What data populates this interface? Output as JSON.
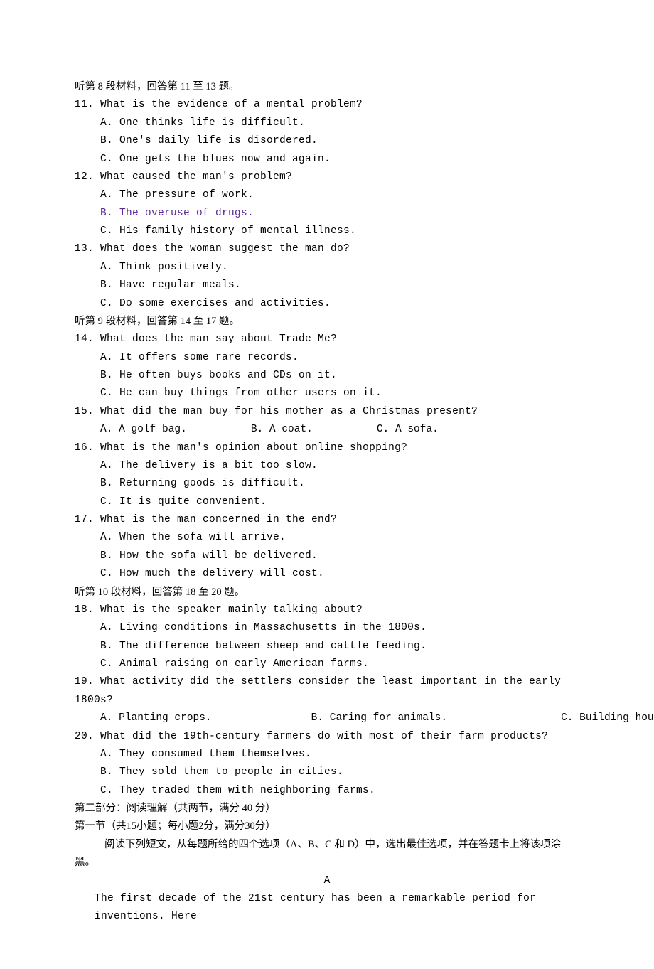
{
  "section8_intro": "听第 8 段材料，回答第 11 至 13 题。",
  "q11": {
    "stem": "11. What is the evidence of a mental problem?",
    "a": "A. One thinks life is difficult.",
    "b": "B. One's daily life is disordered.",
    "c": "C. One gets the blues now and again."
  },
  "q12": {
    "stem": "12. What caused the man's problem?",
    "a": "A. The pressure of work.",
    "b": "B. The overuse of drugs.",
    "c": "C. His family history of mental illness."
  },
  "q13": {
    "stem": "13. What does the woman suggest the man do?",
    "a": "A. Think positively.",
    "b": "B. Have regular meals.",
    "c": "C. Do some exercises and activities."
  },
  "section9_intro": "听第 9 段材料，回答第 14 至 17 题。",
  "q14": {
    "stem": "14. What does the man say about Trade Me?",
    "a": "A. It offers some rare records.",
    "b": "B. He often buys books and CDs on it.",
    "c": "C. He can buy things from other users on it."
  },
  "q15": {
    "stem": "15. What did the man buy for his mother as a Christmas present?",
    "a": "A. A golf bag.",
    "b": "B. A coat.",
    "c": "C. A sofa."
  },
  "q16": {
    "stem": "16. What is the man's opinion about online shopping?",
    "a": "A. The delivery is a bit too slow.",
    "b": "B. Returning goods is difficult.",
    "c": "C. It is quite convenient."
  },
  "q17": {
    "stem": "17. What is the man concerned in the end?",
    "a": "A. When the sofa will arrive.",
    "b": "B. How the sofa will be delivered.",
    "c": "C. How much the delivery will cost."
  },
  "section10_intro": "听第 10 段材料，回答第 18 至 20 题。",
  "q18": {
    "stem": "18. What is the speaker mainly talking about?",
    "a": "A. Living conditions in Massachusetts in the 1800s.",
    "b": "B. The difference between sheep and cattle feeding.",
    "c": "C. Animal raising on early American farms."
  },
  "q19": {
    "stem": "19. What activity did the settlers consider the least important in the early 1800s?",
    "a": "A. Planting crops.",
    "b": "B. Caring for animals.",
    "c": "C. Building houses."
  },
  "q20": {
    "stem": "20. What did the 19th-century farmers do with most of their farm products?",
    "a": "A. They consumed them themselves.",
    "b": "B. They sold them to people in cities.",
    "c": "C. They traded them with neighboring farms."
  },
  "part2_heading": "第二部分：阅读理解（共两节，满分 40 分）",
  "part2_sub": "第一节（共15小题；每小题2分，满分30分）",
  "part2_instr": "阅读下列短文，从每题所给的四个选项（A、B、C 和 D）中，选出最佳选项，并在答题卡上将该项涂黑。",
  "passage_a_label": "A",
  "passage_a_start": "The first decade of the 21st century has been a remarkable period for inventions. Here"
}
